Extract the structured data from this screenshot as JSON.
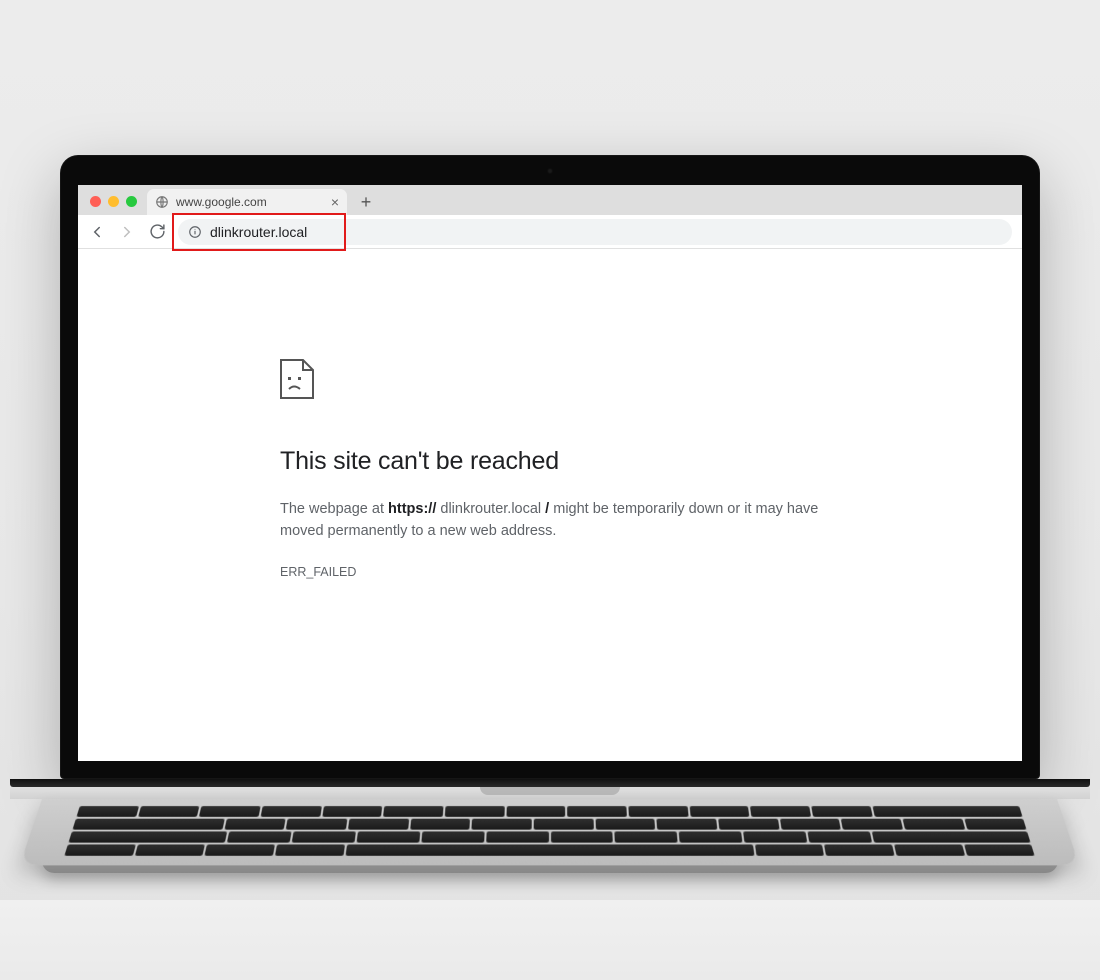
{
  "tab": {
    "title": "www.google.com"
  },
  "addressBar": {
    "url": "dlinkrouter.local"
  },
  "error": {
    "heading": "This site can't be reached",
    "desc_prefix": "The webpage at ",
    "desc_scheme": "https://",
    "desc_host": "dlinkrouter.local",
    "desc_slash": " / ",
    "desc_suffix": "might be temporarily down or it may have moved permanently to a new web address.",
    "code": "ERR_FAILED"
  }
}
